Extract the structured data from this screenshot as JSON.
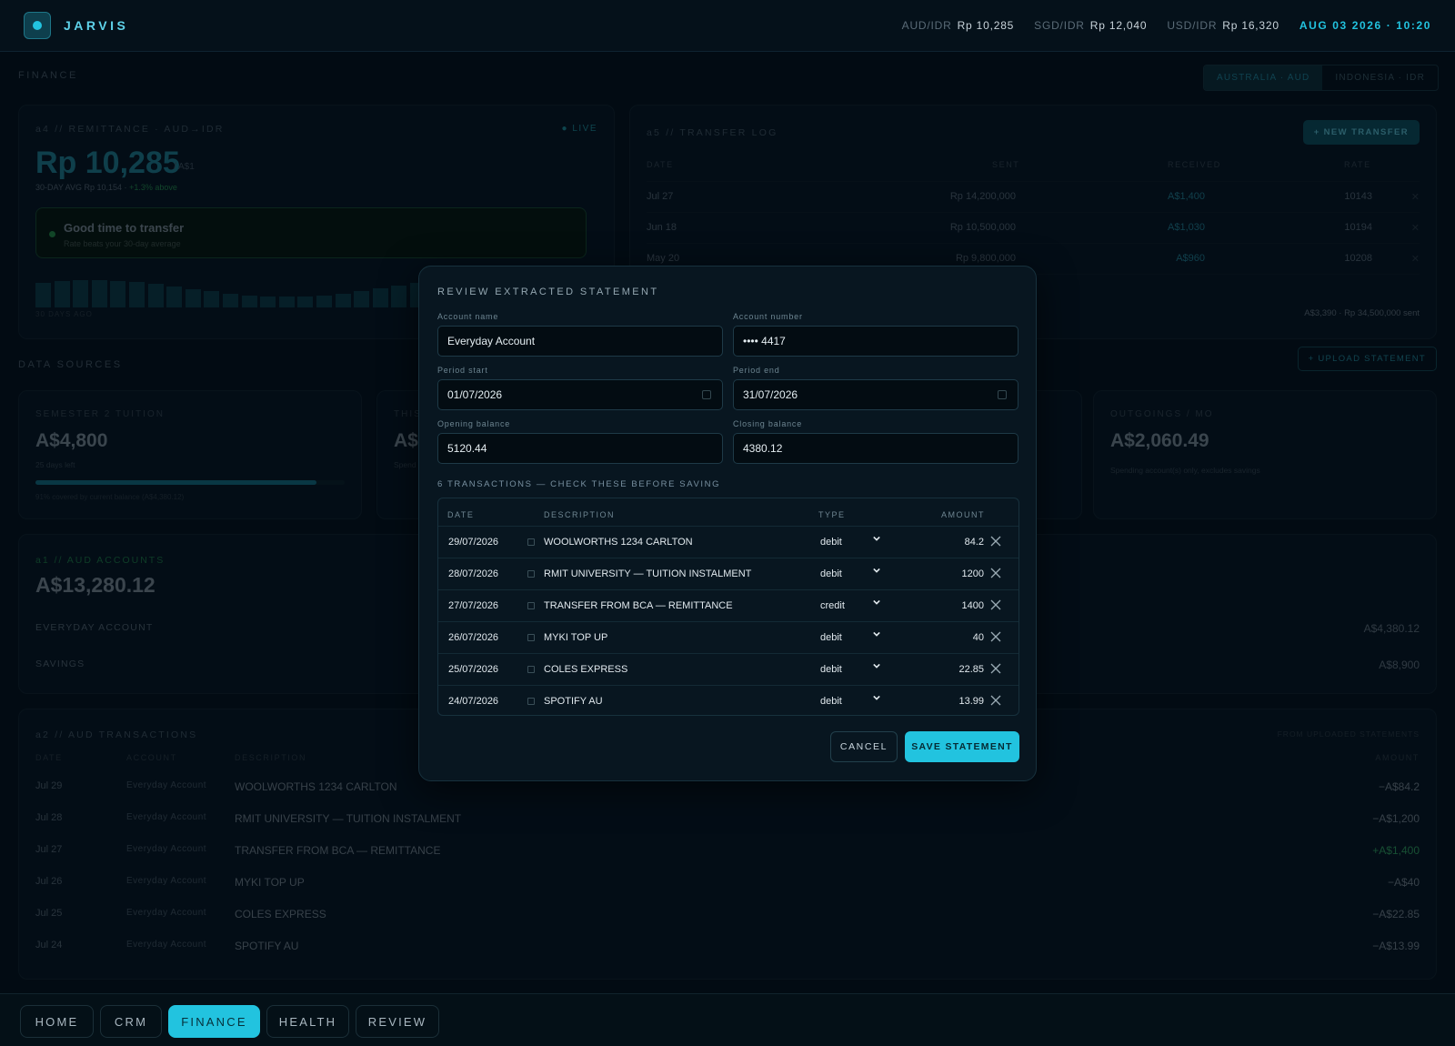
{
  "app": {
    "brand": "JARVIS"
  },
  "header": {
    "rates": [
      {
        "key": "AUD/IDR",
        "value": "Rp 10,285"
      },
      {
        "key": "SGD/IDR",
        "value": "Rp 12,040"
      },
      {
        "key": "USD/IDR",
        "value": "Rp 16,320"
      }
    ],
    "clock": "AUG 03 2026 · 10:20"
  },
  "finance": {
    "title": "FINANCE",
    "country_tabs": [
      "AUSTRALIA · AUD",
      "INDONESIA · IDR"
    ]
  },
  "remittance": {
    "label": "a4 // REMITTANCE · AUD→IDR",
    "live": "● LIVE",
    "rate": "Rp 10,285",
    "per": "/ A$1",
    "avg": "30-DAY AVG Rp 10,154 ·",
    "avg_delta": "+1.3% above",
    "banner_title": "Good time to transfer",
    "banner_sub": "Rate beats your 30-day average",
    "bars_label": "30 DAYS AGO",
    "bar_values": [
      0.85,
      0.9,
      0.95,
      0.95,
      0.92,
      0.88,
      0.8,
      0.72,
      0.62,
      0.55,
      0.48,
      0.42,
      0.38,
      0.36,
      0.38,
      0.42,
      0.48,
      0.55,
      0.65,
      0.75,
      0.85
    ]
  },
  "transfer_log": {
    "label": "a5 // TRANSFER LOG",
    "new_button": "+ NEW TRANSFER",
    "columns": [
      "DATE",
      "SENT",
      "RECEIVED",
      "RATE"
    ],
    "rows": [
      {
        "date": "Jul 27",
        "sent": "Rp 14,200,000",
        "received": "A$1,400",
        "rate": "10143"
      },
      {
        "date": "Jun 18",
        "sent": "Rp 10,500,000",
        "received": "A$1,030",
        "rate": "10194"
      },
      {
        "date": "May 20",
        "sent": "Rp 9,800,000",
        "received": "A$960",
        "rate": "10208"
      }
    ],
    "footer": "A$3,390 · Rp 34,500,000 sent"
  },
  "data_sources": {
    "title": "DATA SOURCES",
    "upload_button": "+ UPLOAD STATEMENT",
    "tuition": {
      "label": "SEMESTER 2 TUITION",
      "value": "A$4,800",
      "sub": "25 days left",
      "progress": 0.91,
      "note": "91% covered by current balance (A$4,380.12)"
    },
    "partial": {
      "label": "THIS",
      "value": "A$",
      "sub": "Spend"
    },
    "outgoings": {
      "label": "OUTGOINGS / MO",
      "value": "A$2,060.49",
      "sub": "Spending account(s) only, excludes savings"
    }
  },
  "accounts": {
    "label": "a1 // AUD ACCOUNTS",
    "total": "A$13,280.12",
    "rows": [
      {
        "name": "EVERYDAY ACCOUNT",
        "amount": "A$4,380.12"
      },
      {
        "name": "SAVINGS",
        "amount": "A$8,900"
      }
    ]
  },
  "transactions": {
    "label": "a2 // AUD TRANSACTIONS",
    "source_note": "FROM UPLOADED STATEMENTS",
    "columns": [
      "DATE",
      "ACCOUNT",
      "DESCRIPTION",
      "AMOUNT"
    ],
    "rows": [
      {
        "date": "Jul 29",
        "account": "Everyday Account",
        "description": "WOOLWORTHS 1234 CARLTON",
        "amount": "−A$84.2"
      },
      {
        "date": "Jul 28",
        "account": "Everyday Account",
        "description": "RMIT UNIVERSITY — TUITION INSTALMENT",
        "amount": "−A$1,200"
      },
      {
        "date": "Jul 27",
        "account": "Everyday Account",
        "description": "TRANSFER FROM BCA — REMITTANCE",
        "amount": "+A$1,400"
      },
      {
        "date": "Jul 26",
        "account": "Everyday Account",
        "description": "MYKI TOP UP",
        "amount": "−A$40"
      },
      {
        "date": "Jul 25",
        "account": "Everyday Account",
        "description": "COLES EXPRESS",
        "amount": "−A$22.85"
      },
      {
        "date": "Jul 24",
        "account": "Everyday Account",
        "description": "SPOTIFY AU",
        "amount": "−A$13.99"
      }
    ]
  },
  "modal": {
    "title": "REVIEW EXTRACTED STATEMENT",
    "fields": {
      "account_name": {
        "label": "Account name",
        "value": "Everyday Account"
      },
      "account_number": {
        "label": "Account number",
        "value": "•••• 4417"
      },
      "period_start": {
        "label": "Period start",
        "value": "01/07/2026"
      },
      "period_end": {
        "label": "Period end",
        "value": "31/07/2026"
      },
      "opening_balance": {
        "label": "Opening balance",
        "value": "5120.44"
      },
      "closing_balance": {
        "label": "Closing balance",
        "value": "4380.12"
      }
    },
    "caption": "6 TRANSACTIONS — CHECK THESE BEFORE SAVING",
    "columns": [
      "DATE",
      "DESCRIPTION",
      "TYPE",
      "AMOUNT"
    ],
    "rows": [
      {
        "date": "29/07/2026",
        "description": "WOOLWORTHS 1234 CARLTON",
        "type": "debit",
        "amount": "84.2"
      },
      {
        "date": "28/07/2026",
        "description": "RMIT UNIVERSITY — TUITION INSTALMENT",
        "type": "debit",
        "amount": "1200"
      },
      {
        "date": "27/07/2026",
        "description": "TRANSFER FROM BCA — REMITTANCE",
        "type": "credit",
        "amount": "1400"
      },
      {
        "date": "26/07/2026",
        "description": "MYKI TOP UP",
        "type": "debit",
        "amount": "40"
      },
      {
        "date": "25/07/2026",
        "description": "COLES EXPRESS",
        "type": "debit",
        "amount": "22.85"
      },
      {
        "date": "24/07/2026",
        "description": "SPOTIFY AU",
        "type": "debit",
        "amount": "13.99"
      }
    ],
    "cancel": "CANCEL",
    "save": "SAVE STATEMENT"
  },
  "nav": {
    "items": [
      "HOME",
      "CRM",
      "FINANCE",
      "HEALTH",
      "REVIEW"
    ],
    "active": "FINANCE"
  }
}
